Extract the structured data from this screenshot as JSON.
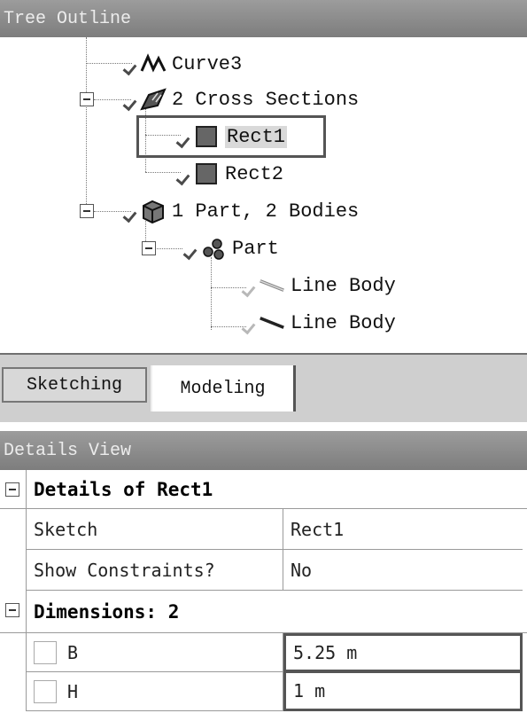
{
  "tree_outline": {
    "title": "Tree Outline",
    "nodes": [
      {
        "label": "Curve3"
      },
      {
        "label": "2 Cross Sections"
      },
      {
        "label": "Rect1"
      },
      {
        "label": "Rect2"
      },
      {
        "label": "1 Part, 2 Bodies"
      },
      {
        "label": "Part"
      },
      {
        "label": "Line Body"
      },
      {
        "label": "Line Body"
      }
    ],
    "selected": "Rect1"
  },
  "tabs": {
    "sketching": "Sketching",
    "modeling": "Modeling",
    "active": "Modeling"
  },
  "details_view": {
    "title": "Details View",
    "group1": {
      "title": "Details of Rect1",
      "rows": [
        {
          "name": "Sketch",
          "value": "Rect1"
        },
        {
          "name": "Show Constraints?",
          "value": "No"
        }
      ]
    },
    "group2": {
      "title": "Dimensions: 2",
      "rows": [
        {
          "name": "B",
          "value": "5.25 m"
        },
        {
          "name": "H",
          "value": "1 m"
        }
      ]
    }
  },
  "colors": {
    "header_bg": "#8c8c8c",
    "header_text": "#ececec",
    "tab_strip": "#cfcfcf"
  }
}
